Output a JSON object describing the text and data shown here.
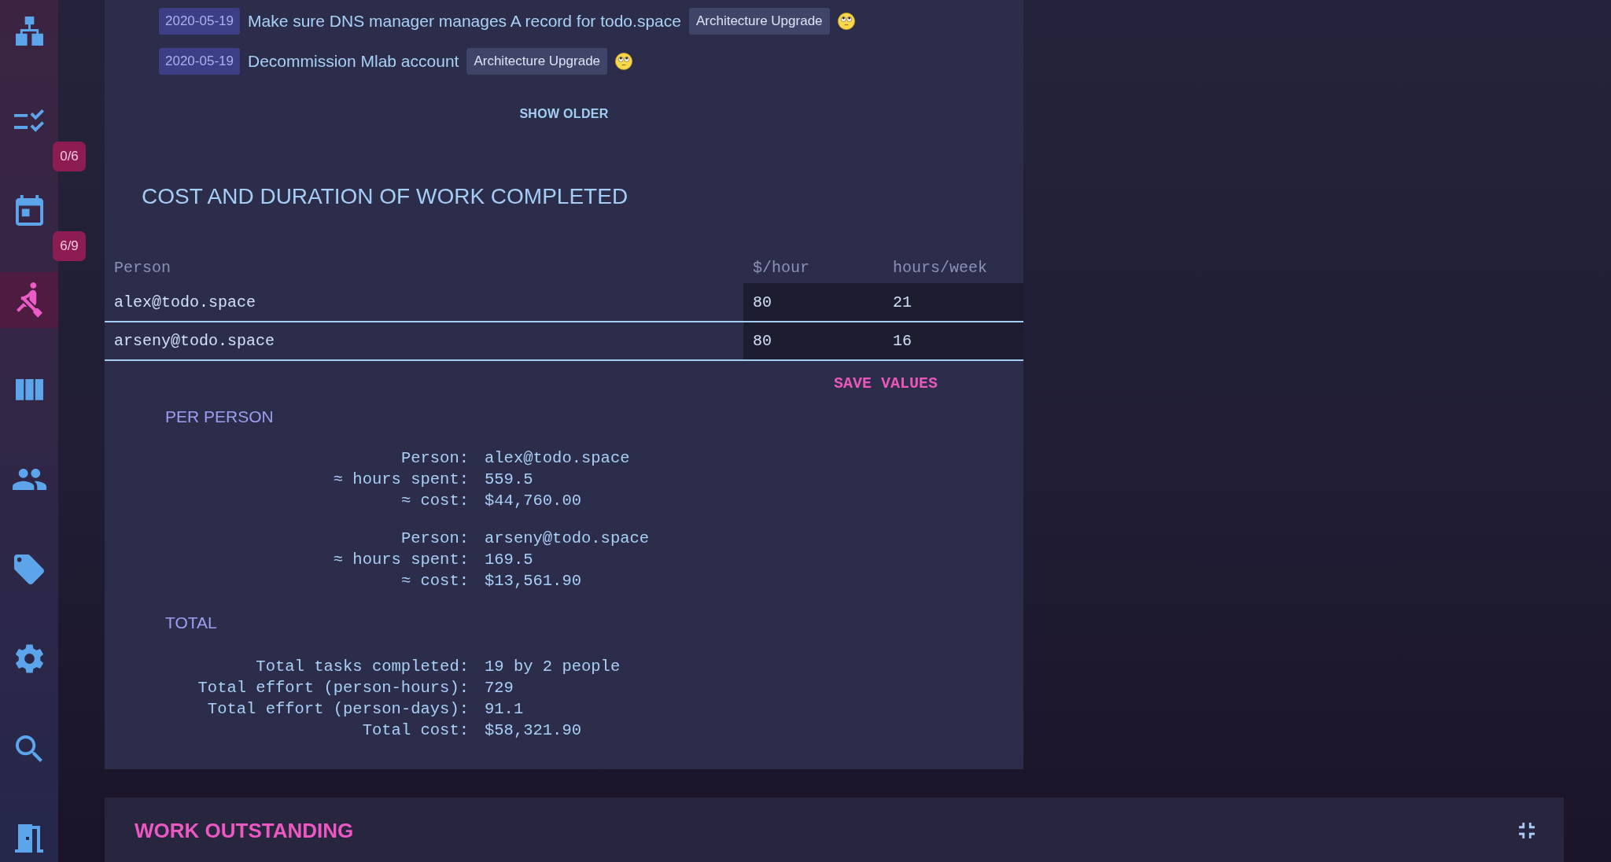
{
  "sidebar": {
    "items": [
      {
        "kind": "sitemap",
        "selected": false
      },
      {
        "kind": "checklist",
        "selected": false,
        "badge": "0/6"
      },
      {
        "kind": "calendar",
        "selected": false,
        "badge": "6/9"
      },
      {
        "kind": "rower",
        "selected": true
      },
      {
        "kind": "columns",
        "selected": false
      },
      {
        "kind": "people",
        "selected": false
      },
      {
        "kind": "tag",
        "selected": false
      },
      {
        "kind": "settings",
        "selected": false
      },
      {
        "kind": "search",
        "selected": false
      },
      {
        "kind": "door",
        "selected": false
      }
    ]
  },
  "recent_tasks": [
    {
      "date": "2020-05-19",
      "title": "Make sure DNS manager manages A record for todo.space",
      "tag": "Architecture Upgrade"
    },
    {
      "date": "2020-05-19",
      "title": "Decommission Mlab account",
      "tag": "Architecture Upgrade"
    }
  ],
  "show_older": "SHOW OLDER",
  "cost": {
    "title": "COST AND DURATION OF WORK COMPLETED",
    "table": {
      "columns": [
        "Person",
        "$/hour",
        "hours/week"
      ],
      "rows": [
        {
          "person": "alex@todo.space",
          "rate": "80",
          "hours": "21"
        },
        {
          "person": "arseny@todo.space",
          "rate": "80",
          "hours": "16"
        }
      ]
    },
    "save_button": "SAVE VALUES",
    "per_person": {
      "title": "PER PERSON",
      "people": [
        {
          "lines": [
            {
              "label": "Person:",
              "value": "alex@todo.space"
            },
            {
              "label": "≈ hours spent:",
              "value": "559.5"
            },
            {
              "label": "≈ cost:",
              "value": "$44,760.00"
            }
          ]
        },
        {
          "lines": [
            {
              "label": "Person:",
              "value": "arseny@todo.space"
            },
            {
              "label": "≈ hours spent:",
              "value": "169.5"
            },
            {
              "label": "≈ cost:",
              "value": "$13,561.90"
            }
          ]
        }
      ]
    },
    "total": {
      "title": "TOTAL",
      "lines": [
        {
          "label": "Total tasks completed:",
          "value": "19 by 2 people"
        },
        {
          "label": "Total effort (person-hours):",
          "value": "729"
        },
        {
          "label": "Total effort (person-days):",
          "value": "91.1"
        },
        {
          "label": "Total cost:",
          "value": "$58,321.90"
        }
      ]
    }
  },
  "work_outstanding": {
    "title": "WORK OUTSTANDING"
  }
}
